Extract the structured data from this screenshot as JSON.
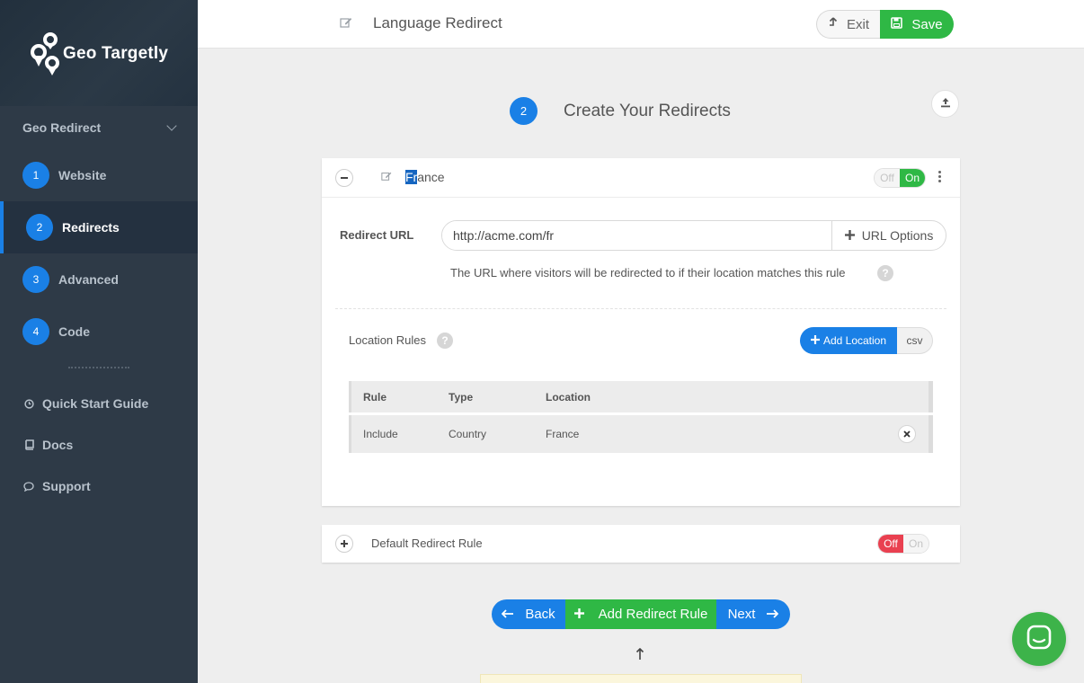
{
  "brand": {
    "name": "Geo Targetly"
  },
  "sidebar": {
    "section_label": "Geo Redirect",
    "steps": [
      {
        "num": "1",
        "label": "Website",
        "active": false
      },
      {
        "num": "2",
        "label": "Redirects",
        "active": true
      },
      {
        "num": "3",
        "label": "Advanced",
        "active": false
      },
      {
        "num": "4",
        "label": "Code",
        "active": false
      }
    ],
    "links": [
      {
        "label": "Quick Start Guide",
        "icon": "clock-icon"
      },
      {
        "label": "Docs",
        "icon": "book-icon"
      },
      {
        "label": "Support",
        "icon": "chat-bubble-icon"
      }
    ]
  },
  "topbar": {
    "title": "Language Redirect",
    "exit_label": "Exit",
    "save_label": "Save"
  },
  "step": {
    "number": "2",
    "title": "Create Your Redirects"
  },
  "rule": {
    "name_selected": "Fr",
    "name_rest": "ance",
    "toggle_off": "Off",
    "toggle_on": "On",
    "state": "On",
    "redirect_url_label": "Redirect URL",
    "redirect_url_value": "http://acme.com/fr",
    "url_options_label": "URL Options",
    "url_help": "The URL where visitors will be redirected to if their location matches this rule",
    "help_glyph": "?",
    "location_rules_label": "Location Rules",
    "add_location_label": "Add Location",
    "csv_label": "csv",
    "table": {
      "headers": [
        "Rule",
        "Type",
        "Location"
      ],
      "rows": [
        [
          "Include",
          "Country",
          "France"
        ]
      ]
    }
  },
  "default_rule": {
    "name": "Default Redirect Rule",
    "toggle_off": "Off",
    "toggle_on": "On",
    "state": "Off"
  },
  "footer_nav": {
    "back_label": "Back",
    "add_rule_label": "Add Redirect Rule",
    "next_label": "Next"
  },
  "colors": {
    "primary_blue": "#1a80e6",
    "green": "#2fb845",
    "red_off": "#e94050",
    "sidebar_bg": "#2e3a47"
  }
}
